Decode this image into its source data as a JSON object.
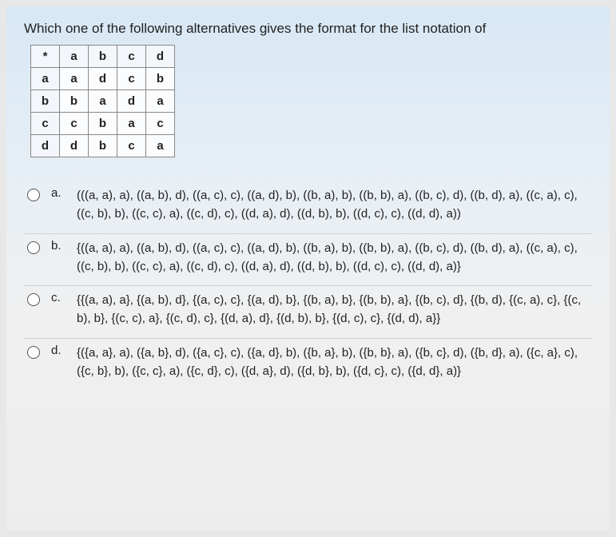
{
  "question": "Which one of the following alternatives gives the format for the list notation of",
  "table": {
    "header": [
      "*",
      "a",
      "b",
      "c",
      "d"
    ],
    "rows": [
      [
        "a",
        "a",
        "d",
        "c",
        "b"
      ],
      [
        "b",
        "b",
        "a",
        "d",
        "a"
      ],
      [
        "c",
        "c",
        "b",
        "a",
        "c"
      ],
      [
        "d",
        "d",
        "b",
        "c",
        "a"
      ]
    ]
  },
  "options": [
    {
      "label": "a.",
      "text": "(((a, a), a), ((a, b), d), ((a, c), c), ((a, d), b), ((b, a), b), ((b, b), a), ((b, c), d), ((b, d), a), ((c, a), c), ((c, b), b), ((c, c), a), ((c, d), c), ((d, a), d), ((d, b), b), ((d, c), c), ((d, d), a))"
    },
    {
      "label": "b.",
      "text": "{((a, a), a), ((a, b), d), ((a, c), c), ((a, d), b), ((b, a), b), ((b, b), a), ((b, c), d), ((b, d), a), ((c, a), c), ((c, b), b), ((c, c), a), ((c, d), c), ((d, a), d), ((d, b), b), ((d, c), c), ((d, d), a)}"
    },
    {
      "label": "c.",
      "text": "{{(a, a), a}, {(a, b), d}, {(a, c), c}, {(a, d), b}, {(b, a), b}, {(b, b), a}, {(b, c), d}, {(b, d), {(c, a), c}, {(c, b), b}, {(c, c), a}, {(c, d), c}, {(d, a), d}, {(d, b), b}, {(d, c), c}, {(d, d), a}}"
    },
    {
      "label": "d.",
      "text": "{({a, a}, a), ({a, b}, d), ({a, c}, c), ({a, d}, b), ({b, a}, b), ({b, b}, a), ({b, c}, d), ({b, d}, a), ({c, a}, c), ({c, b}, b), ({c, c}, a), ({c, d}, c), ({d, a}, d), ({d, b}, b), ({d, c}, c), ({d, d}, a)}"
    }
  ]
}
